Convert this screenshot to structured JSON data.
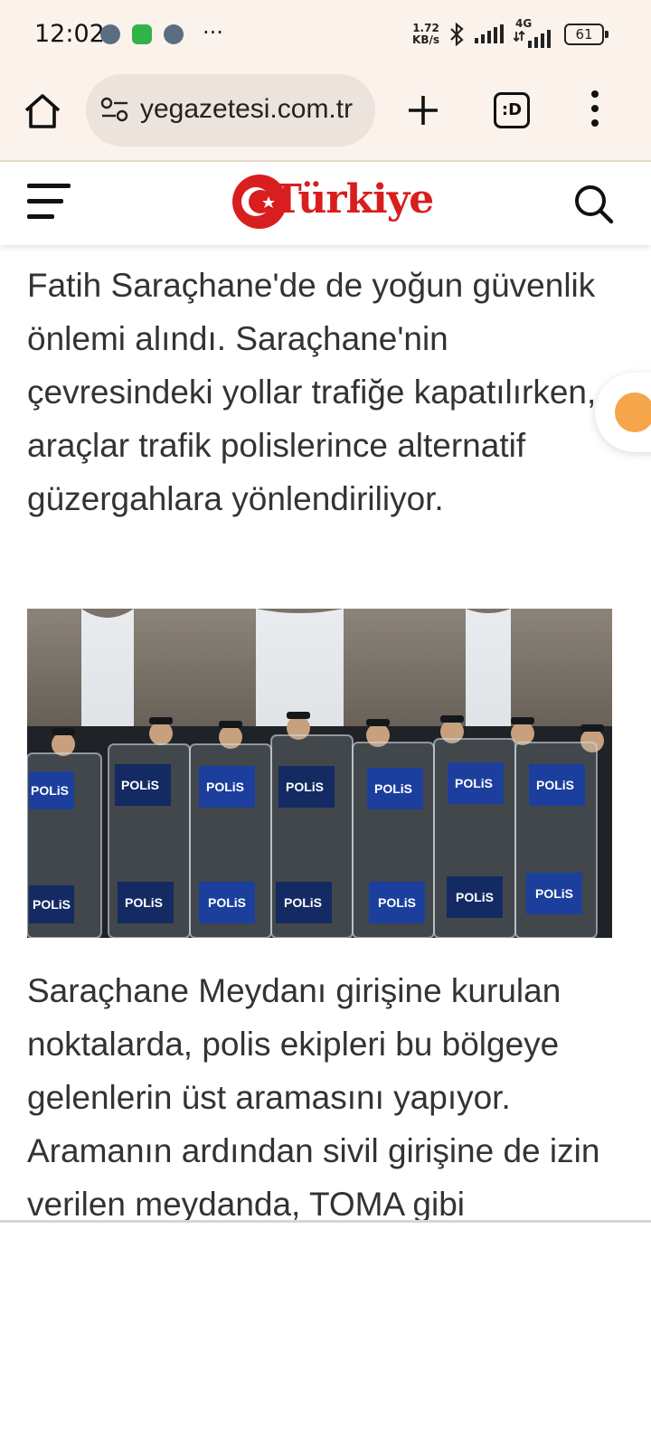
{
  "status_bar": {
    "time": "12:02",
    "notification_icons": [
      "telegram-icon",
      "whatsapp-business-icon",
      "telegram-icon"
    ],
    "more_indicator": "···",
    "net_speed_value": "1.72",
    "net_speed_unit": "KB/s",
    "network_type": "4G",
    "battery": "61"
  },
  "browser": {
    "url": "yegazetesi.com.tr",
    "tabs_label": ":D"
  },
  "site": {
    "logo_text": "Türkiye",
    "brand_color": "#d81e1e"
  },
  "article": {
    "paragraph_1": "Fatih Saraçhane'de de yoğun güvenlik önlemi alındı. Saraçhane'nin çevresindeki yollar trafiğe kapatılırken, araçlar trafik polislerince alternatif güzergahlara yönlendiriliyor.",
    "photo_shield_text": "POLiS",
    "paragraph_2": "Saraçhane Meydanı girişine kurulan noktalarda, polis ekipleri bu bölgeye gelenlerin üst aramasını yapıyor. Aramanın ardından sivil girişine de izin verilen meydanda, TOMA gibi"
  }
}
